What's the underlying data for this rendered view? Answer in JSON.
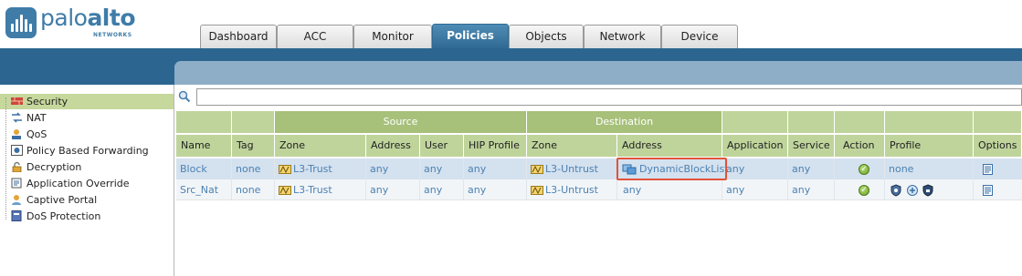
{
  "brand": {
    "word_light": "palo",
    "word_bold": "alto",
    "sub": "NETWORKS"
  },
  "nav_tabs": [
    {
      "label": "Dashboard",
      "active": false
    },
    {
      "label": "ACC",
      "active": false
    },
    {
      "label": "Monitor",
      "active": false
    },
    {
      "label": "Policies",
      "active": true
    },
    {
      "label": "Objects",
      "active": false
    },
    {
      "label": "Network",
      "active": false
    },
    {
      "label": "Device",
      "active": false
    }
  ],
  "sidebar": {
    "items": [
      {
        "label": "Security",
        "icon": "security-rule-icon",
        "active": true
      },
      {
        "label": "NAT",
        "icon": "nat-icon",
        "active": false
      },
      {
        "label": "QoS",
        "icon": "qos-icon",
        "active": false
      },
      {
        "label": "Policy Based Forwarding",
        "icon": "pbf-icon",
        "active": false
      },
      {
        "label": "Decryption",
        "icon": "lock-icon",
        "active": false
      },
      {
        "label": "Application Override",
        "icon": "app-override-icon",
        "active": false
      },
      {
        "label": "Captive Portal",
        "icon": "portal-icon",
        "active": false
      },
      {
        "label": "DoS Protection",
        "icon": "dos-icon",
        "active": false
      }
    ]
  },
  "search": {
    "placeholder": "",
    "value": ""
  },
  "table": {
    "groups": {
      "source": "Source",
      "destination": "Destination"
    },
    "columns": [
      "Name",
      "Tag",
      "Zone",
      "Address",
      "User",
      "HIP Profile",
      "Zone",
      "Address",
      "Application",
      "Service",
      "Action",
      "Profile",
      "Options"
    ],
    "rows": [
      {
        "name": "Block",
        "tag": "none",
        "src_zone": "L3-Trust",
        "src_address": "any",
        "user": "any",
        "hip": "any",
        "dst_zone": "L3-Untrust",
        "dst_address": "DynamicBlockList",
        "application": "any",
        "service": "any",
        "action": "allow",
        "profile": "none"
      },
      {
        "name": "Src_Nat",
        "tag": "none",
        "src_zone": "L3-Trust",
        "src_address": "any",
        "user": "any",
        "hip": "any",
        "dst_zone": "L3-Untrust",
        "dst_address": "any",
        "application": "any",
        "service": "any",
        "action": "allow",
        "profile": ""
      }
    ]
  },
  "colors": {
    "brand_blue": "#3f7ca8",
    "band_blue": "#2c6690",
    "header_green": "#bfd49b",
    "link_blue": "#4b82b2",
    "highlight": "#e0533a"
  }
}
